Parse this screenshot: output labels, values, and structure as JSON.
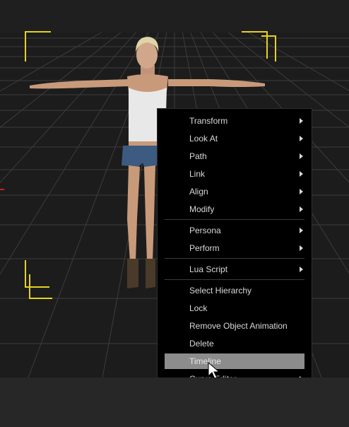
{
  "context_menu": {
    "items": [
      {
        "label": "Transform",
        "submenu": true
      },
      {
        "label": "Look At",
        "submenu": true
      },
      {
        "label": "Path",
        "submenu": true
      },
      {
        "label": "Link",
        "submenu": true
      },
      {
        "label": "Align",
        "submenu": true
      },
      {
        "label": "Modify",
        "submenu": true
      },
      {
        "label": "Persona",
        "submenu": true
      },
      {
        "label": "Perform",
        "submenu": true
      },
      {
        "label": "Lua Script",
        "submenu": true
      },
      {
        "label": "Select Hierarchy",
        "submenu": false
      },
      {
        "label": "Lock",
        "submenu": false
      },
      {
        "label": "Remove Object Animation",
        "submenu": false
      },
      {
        "label": "Delete",
        "submenu": false
      },
      {
        "label": "Timeline",
        "submenu": false,
        "highlighted": true
      },
      {
        "label": "Curve Editor",
        "submenu": true
      }
    ]
  },
  "colors": {
    "viewport_bg": "#1c1c1c",
    "grid_line": "#3c3c3c",
    "bracket": "#e6d21e",
    "menu_bg": "#000000",
    "menu_text": "#d8d8d8",
    "highlight": "#8c8c8c"
  }
}
